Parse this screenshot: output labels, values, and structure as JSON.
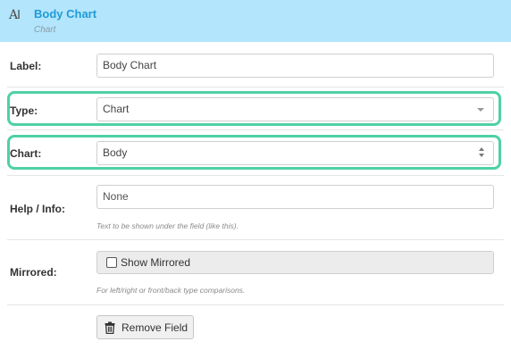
{
  "header": {
    "icon": "text-field-icon",
    "icon_text": "A",
    "title": "Body Chart",
    "subtitle": "Chart"
  },
  "fields": {
    "label": {
      "label": "Label:",
      "value": "Body Chart"
    },
    "type": {
      "label": "Type:",
      "value": "Chart"
    },
    "chart": {
      "label": "Chart:",
      "value": "Body"
    },
    "help": {
      "label": "Help / Info:",
      "value": "None",
      "hint": "Text to be shown under the field (like this)."
    },
    "mirrored": {
      "label": "Mirrored:",
      "checkbox_label": "Show Mirrored",
      "checked": false,
      "hint": "For left/right or front/back type comparisons."
    }
  },
  "actions": {
    "remove_label": "Remove Field"
  },
  "colors": {
    "header_bg": "#b3e5fc",
    "title": "#1e9bd7",
    "highlight": "#4fd1a5"
  }
}
